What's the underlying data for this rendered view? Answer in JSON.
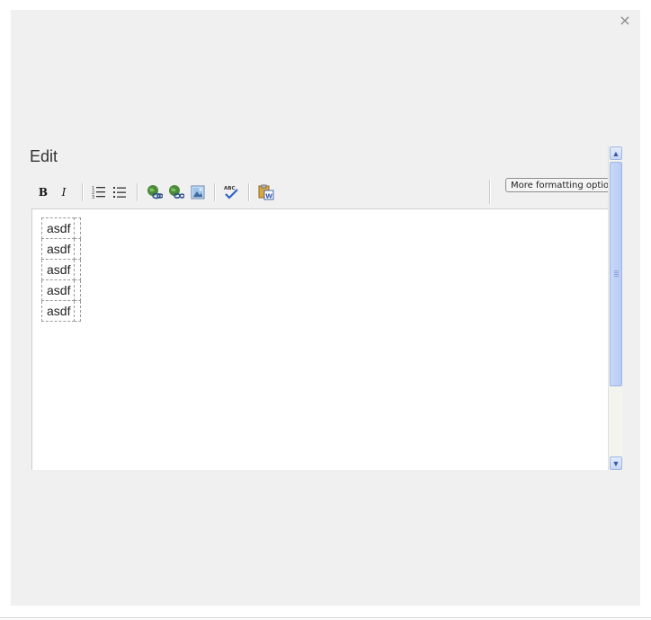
{
  "dialog": {
    "close_label": "×",
    "title": "Edit"
  },
  "toolbar": {
    "buttons": [
      {
        "name": "bold",
        "icon": "bold-icon",
        "label": "B"
      },
      {
        "name": "italic",
        "icon": "italic-icon",
        "label": "I"
      },
      {
        "name": "numbered-list",
        "icon": "numbered-list-icon"
      },
      {
        "name": "bulleted-list",
        "icon": "bulleted-list-icon"
      },
      {
        "name": "insert-link",
        "icon": "link-icon"
      },
      {
        "name": "remove-link",
        "icon": "unlink-icon"
      },
      {
        "name": "insert-image",
        "icon": "image-icon"
      },
      {
        "name": "spell-check",
        "icon": "spellcheck-icon",
        "label": "ABC"
      },
      {
        "name": "paste-from-word",
        "icon": "paste-word-icon"
      }
    ],
    "more_label": "More formatting options"
  },
  "editor": {
    "rows": [
      "asdf",
      "asdf",
      "asdf",
      "asdf",
      "asdf"
    ]
  },
  "colors": {
    "dialog_bg": "#f0f0f0",
    "scroll_accent": "#b8cbf5"
  }
}
